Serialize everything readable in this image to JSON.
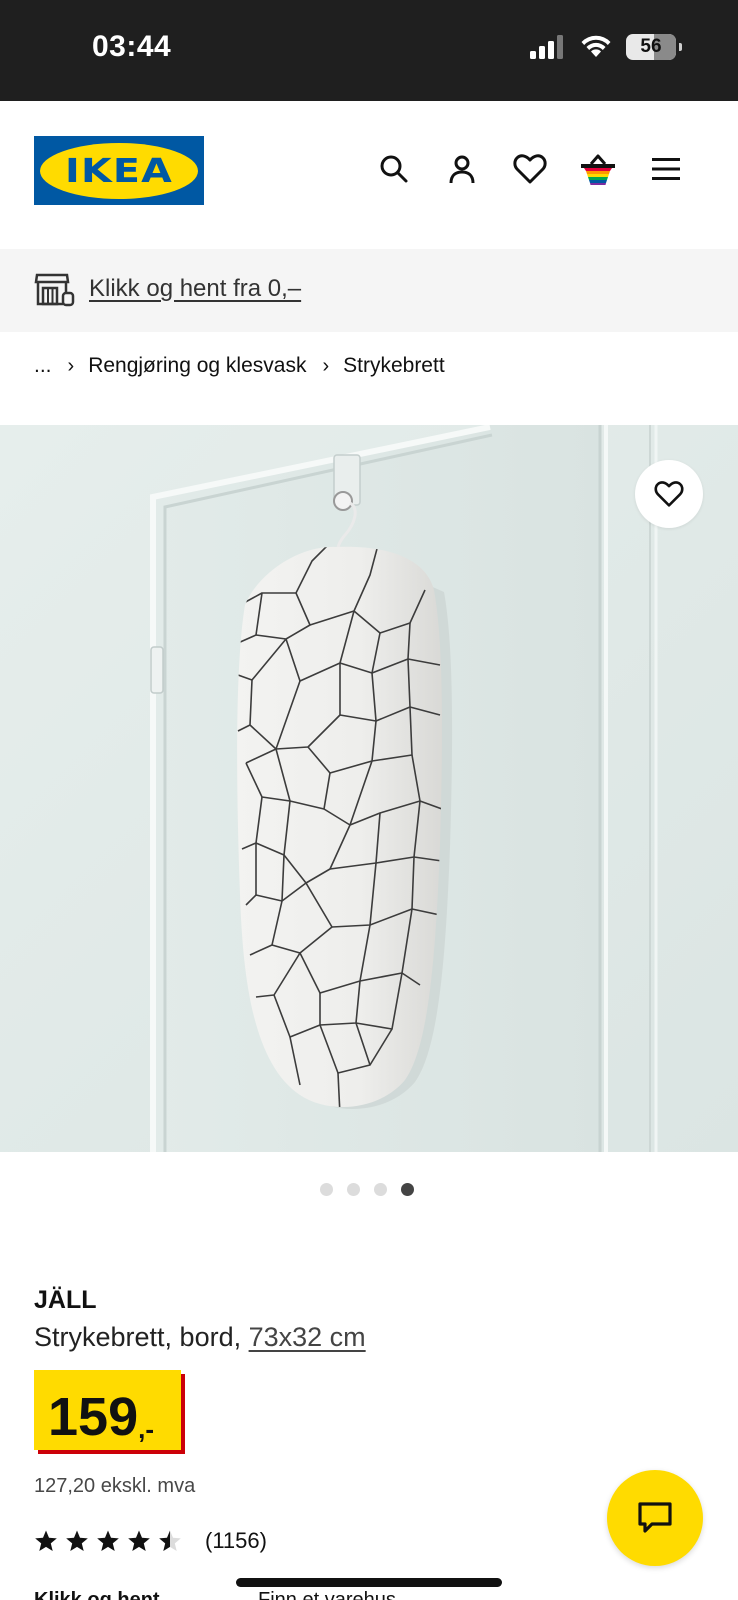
{
  "status_bar": {
    "time": "03:44",
    "battery": "56"
  },
  "header": {
    "logo_text": "IKEA",
    "icons": [
      "search-icon",
      "account-icon",
      "favourites-icon",
      "basket-icon",
      "menu-icon"
    ]
  },
  "promo": {
    "text": "Klikk og hent fra 0,–",
    "icon": "click-collect-icon"
  },
  "breadcrumb": {
    "items": [
      "...",
      "Rengjøring og klesvask",
      "Strykebrett"
    ]
  },
  "gallery": {
    "slide_count": 4,
    "active_index": 3
  },
  "product": {
    "name": "JÄLL",
    "description": "Strykebrett, bord, ",
    "size": "73x32 cm",
    "price_int": "159",
    "price_dec": ",-",
    "price_ex_vat": "127,20 ekskl. mva",
    "rating": 4.5,
    "rating_count": "(1156)"
  },
  "cut_off": {
    "left": "Klikk og hent",
    "right": "Finn et varehus"
  },
  "colors": {
    "ikea_blue": "#0058a3",
    "ikea_yellow": "#ffdb00",
    "price_shadow": "#cc0008"
  }
}
